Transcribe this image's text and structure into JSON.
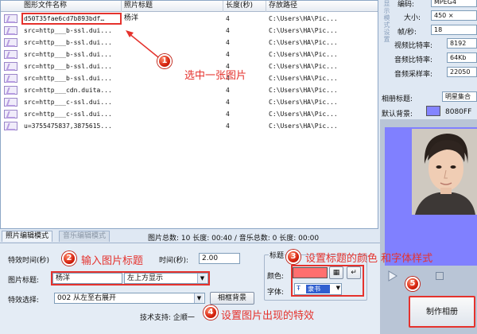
{
  "table": {
    "headers": [
      "图形文件名称",
      "照片标题",
      "长度(秒)",
      "存放路径"
    ],
    "rows": [
      {
        "name": "d50T35fae6cd7b893bdf…",
        "title": "杨洋",
        "duration": "4",
        "path": "C:\\Users\\HA\\Pic..."
      },
      {
        "name": "src=http___b-ssl.dui...",
        "title": "",
        "duration": "4",
        "path": "C:\\Users\\HA\\Pic..."
      },
      {
        "name": "src=http___b-ssl.dui...",
        "title": "",
        "duration": "4",
        "path": "C:\\Users\\HA\\Pic..."
      },
      {
        "name": "src=http___b-ssl.dui...",
        "title": "",
        "duration": "4",
        "path": "C:\\Users\\HA\\Pic..."
      },
      {
        "name": "src=http___b-ssl.dui...",
        "title": "",
        "duration": "4",
        "path": "C:\\Users\\HA\\Pic..."
      },
      {
        "name": "src=http___b-ssl.dui...",
        "title": "",
        "duration": "4",
        "path": "C:\\Users\\HA\\Pic..."
      },
      {
        "name": "src=http___cdn.duita...",
        "title": "",
        "duration": "4",
        "path": "C:\\Users\\HA\\Pic..."
      },
      {
        "name": "src=http___c-ssl.dui...",
        "title": "",
        "duration": "4",
        "path": "C:\\Users\\HA\\Pic..."
      },
      {
        "name": "src=http___c-ssl.dui...",
        "title": "",
        "duration": "4",
        "path": "C:\\Users\\HA\\Pic..."
      },
      {
        "name": "u=3755475837,3875615...",
        "title": "",
        "duration": "4",
        "path": "C:\\Users\\HA\\Pic..."
      }
    ]
  },
  "props": {
    "vertical_label": "显示模式设置",
    "encoding_label": "编码:",
    "encoding_value": "MPEG4",
    "size_label": "大小:",
    "size_value": "450 ×",
    "fps_label": "帧/秒:",
    "fps_value": "18",
    "vbitrate_label": "视频比特率:",
    "vbitrate_value": "8192",
    "abitrate_label": "音频比特率:",
    "abitrate_value": "64Kb",
    "asample_label": "音频采样率:",
    "asample_value": "22050",
    "album_title_label": "相册标题:",
    "album_title_value": "明星集合",
    "bg_label": "默认背景:",
    "bg_value": "8080FF",
    "bg_color": "#8484ff"
  },
  "tabs": {
    "photo_edit": "照片编辑模式",
    "music_edit": "音乐编辑模式"
  },
  "summary": "图片总数: 10 长度: 00:40 / 音乐总数: 0 长度: 00:00",
  "edit": {
    "effect_time_label": "特效时间(秒)",
    "display_time_label": "时间(秒):",
    "display_time_value": "2.00",
    "photo_title_label": "图片标题:",
    "photo_title_value": "杨洋",
    "title_position": "左上方显示",
    "effect_label": "特效选择:",
    "effect_value": "002 从左至右展开",
    "frame_bg_button": "相框背景",
    "title_group_label": "标题",
    "color_label": "颜色:",
    "font_label": "字体:",
    "font_value": "隶书",
    "tech_support": "技术支持: 企顺一"
  },
  "actions": {
    "make_album": "制作相册"
  },
  "annotations": {
    "a1": "选中一张图片",
    "a2": "输入图片标题",
    "a3": "设置标题的颜色 和字体样式",
    "a4": "设置图片出现的特效",
    "n1": "1",
    "n2": "2",
    "n3": "3",
    "n4": "4",
    "n5": "5"
  },
  "colors": {
    "annotation_red": "#e5322d",
    "preview_background": "#8080ff",
    "title_color_swatch": "#ff6f6f"
  }
}
